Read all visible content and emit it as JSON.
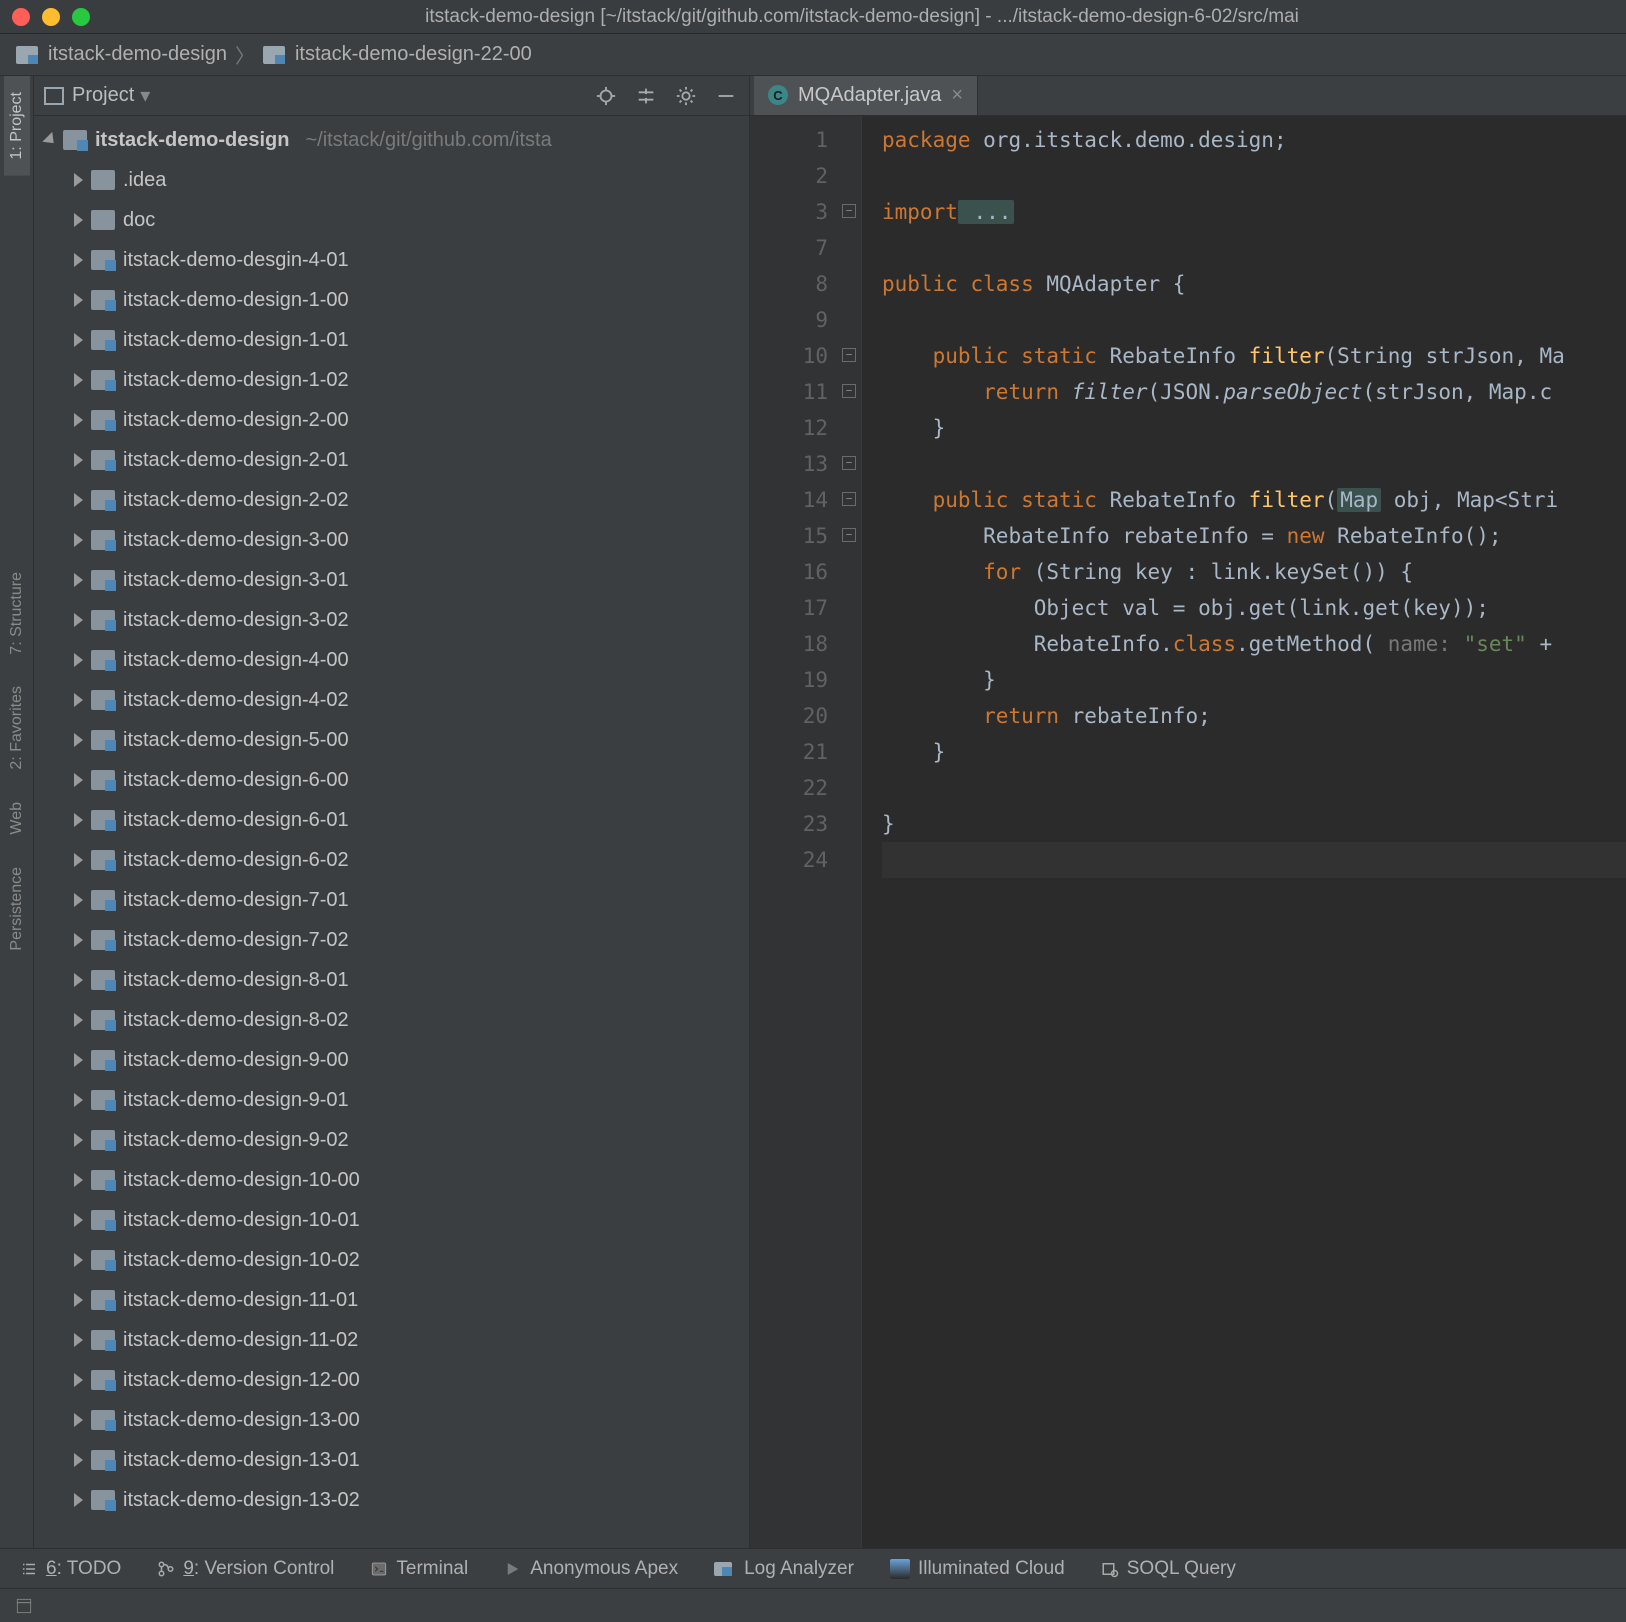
{
  "titlebar": "itstack-demo-design [~/itstack/git/github.com/itstack-demo-design] - .../itstack-demo-design-6-02/src/mai",
  "breadcrumb": {
    "item1": "itstack-demo-design",
    "item2": "itstack-demo-design-22-00"
  },
  "rail": {
    "project": "1: Project",
    "structure": "7: Structure",
    "favorites": "2: Favorites",
    "web": "Web",
    "persistence": "Persistence"
  },
  "projectPane": {
    "title": "Project",
    "root": "itstack-demo-design",
    "rootAux": "~/itstack/git/github.com/itsta",
    "items": [
      {
        "label": ".idea",
        "type": "plain"
      },
      {
        "label": "doc",
        "type": "plain"
      },
      {
        "label": "itstack-demo-desgin-4-01",
        "type": "mod"
      },
      {
        "label": "itstack-demo-design-1-00",
        "type": "mod"
      },
      {
        "label": "itstack-demo-design-1-01",
        "type": "mod"
      },
      {
        "label": "itstack-demo-design-1-02",
        "type": "mod"
      },
      {
        "label": "itstack-demo-design-2-00",
        "type": "mod"
      },
      {
        "label": "itstack-demo-design-2-01",
        "type": "mod"
      },
      {
        "label": "itstack-demo-design-2-02",
        "type": "mod"
      },
      {
        "label": "itstack-demo-design-3-00",
        "type": "mod"
      },
      {
        "label": "itstack-demo-design-3-01",
        "type": "mod"
      },
      {
        "label": "itstack-demo-design-3-02",
        "type": "mod"
      },
      {
        "label": "itstack-demo-design-4-00",
        "type": "mod"
      },
      {
        "label": "itstack-demo-design-4-02",
        "type": "mod"
      },
      {
        "label": "itstack-demo-design-5-00",
        "type": "mod"
      },
      {
        "label": "itstack-demo-design-6-00",
        "type": "mod"
      },
      {
        "label": "itstack-demo-design-6-01",
        "type": "mod"
      },
      {
        "label": "itstack-demo-design-6-02",
        "type": "mod"
      },
      {
        "label": "itstack-demo-design-7-01",
        "type": "mod"
      },
      {
        "label": "itstack-demo-design-7-02",
        "type": "mod"
      },
      {
        "label": "itstack-demo-design-8-01",
        "type": "mod"
      },
      {
        "label": "itstack-demo-design-8-02",
        "type": "mod"
      },
      {
        "label": "itstack-demo-design-9-00",
        "type": "mod"
      },
      {
        "label": "itstack-demo-design-9-01",
        "type": "mod"
      },
      {
        "label": "itstack-demo-design-9-02",
        "type": "mod"
      },
      {
        "label": "itstack-demo-design-10-00",
        "type": "mod"
      },
      {
        "label": "itstack-demo-design-10-01",
        "type": "mod"
      },
      {
        "label": "itstack-demo-design-10-02",
        "type": "mod"
      },
      {
        "label": "itstack-demo-design-11-01",
        "type": "mod"
      },
      {
        "label": "itstack-demo-design-11-02",
        "type": "mod"
      },
      {
        "label": "itstack-demo-design-12-00",
        "type": "mod"
      },
      {
        "label": "itstack-demo-design-13-00",
        "type": "mod"
      },
      {
        "label": "itstack-demo-design-13-01",
        "type": "mod"
      },
      {
        "label": "itstack-demo-design-13-02",
        "type": "mod"
      }
    ]
  },
  "tab": {
    "label": "MQAdapter.java"
  },
  "gutter": {
    "lines": [
      "1",
      "2",
      "3",
      "7",
      "8",
      "9",
      "10",
      "11",
      "12",
      "13",
      "14",
      "15",
      "16",
      "17",
      "18",
      "19",
      "20",
      "21",
      "22",
      "23",
      "24"
    ],
    "markers": {
      "10": "@",
      "14": "@"
    }
  },
  "code": {
    "l1a": "package",
    "l1b": " org.itstack.demo.design;",
    "l3a": "import",
    "l3b": " ...",
    "l8a": "public class",
    "l8b": " MQAdapter {",
    "l10a": "public static",
    "l10b": " RebateInfo ",
    "l10c": "filter",
    "l10d": "(String strJson, Ma",
    "l11a": "return",
    "l11b": " ",
    "l11c": "filter",
    "l11d": "(JSON.",
    "l11e": "parseObject",
    "l11f": "(strJson, Map.c",
    "l12": "}",
    "l14a": "public static",
    "l14b": " RebateInfo ",
    "l14c": "filter",
    "l14d": "(",
    "l14e": "Map",
    "l14f": " obj, Map<Stri",
    "l15a": "RebateInfo rebateInfo = ",
    "l15b": "new",
    "l15c": " RebateInfo();",
    "l16a": "for",
    "l16b": " (String key : link.keySet()) {",
    "l17": "Object val = obj.get(link.get(key));",
    "l18a": "RebateInfo.",
    "l18b": "class",
    "l18c": ".getMethod( ",
    "l18d": "name:",
    "l18e": " \"set\"",
    "l18f": " + ",
    "l19": "}",
    "l20a": "return",
    "l20b": " rebateInfo;",
    "l21": "}",
    "l23": "}"
  },
  "bottom": {
    "todo": "6: TODO",
    "vcs": "9: Version Control",
    "terminal": "Terminal",
    "apex": "Anonymous Apex",
    "log": "Log Analyzer",
    "cloud": "Illuminated Cloud",
    "soql": "SOQL Query"
  }
}
